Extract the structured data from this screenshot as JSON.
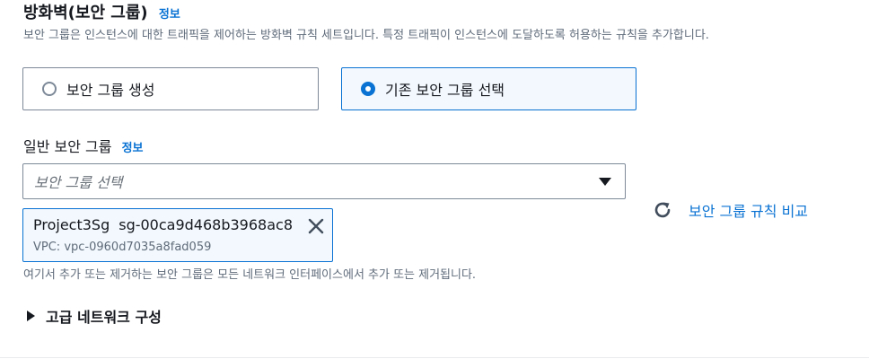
{
  "section": {
    "title": "방화벽(보안 그룹)",
    "info_label": "정보",
    "description": "보안 그룹은 인스턴스에 대한 트래픽을 제어하는 방화벽 규칙 세트입니다. 특정 트래픽이 인스턴스에 도달하도록 허용하는 규칙을 추가합니다."
  },
  "options": [
    {
      "label": "보안 그룹 생성",
      "selected": false
    },
    {
      "label": "기존 보안 그룹 선택",
      "selected": true
    }
  ],
  "common_sg": {
    "label": "일반 보안 그룹",
    "info_label": "정보",
    "placeholder": "보안 그룹 선택",
    "selected_token": {
      "name": "Project3Sg",
      "id": "sg-00ca9d468b3968ac8",
      "vpc": "VPC: vpc-0960d7035a8fad059"
    },
    "helper_text": "여기서 추가 또는 제거하는 보안 그룹은 모든 네트워크 인터페이스에서 추가 또는 제거됩니다."
  },
  "compare": {
    "label": "보안 그룹 규칙 비교",
    "icon": "refresh-icon"
  },
  "advanced": {
    "label": "고급 네트워크 구성",
    "icon": "caret-right-icon"
  },
  "colors": {
    "link": "#0972d3",
    "selected_bg": "#f2f8fd",
    "text": "#16191f",
    "secondary": "#5f6b7a"
  }
}
